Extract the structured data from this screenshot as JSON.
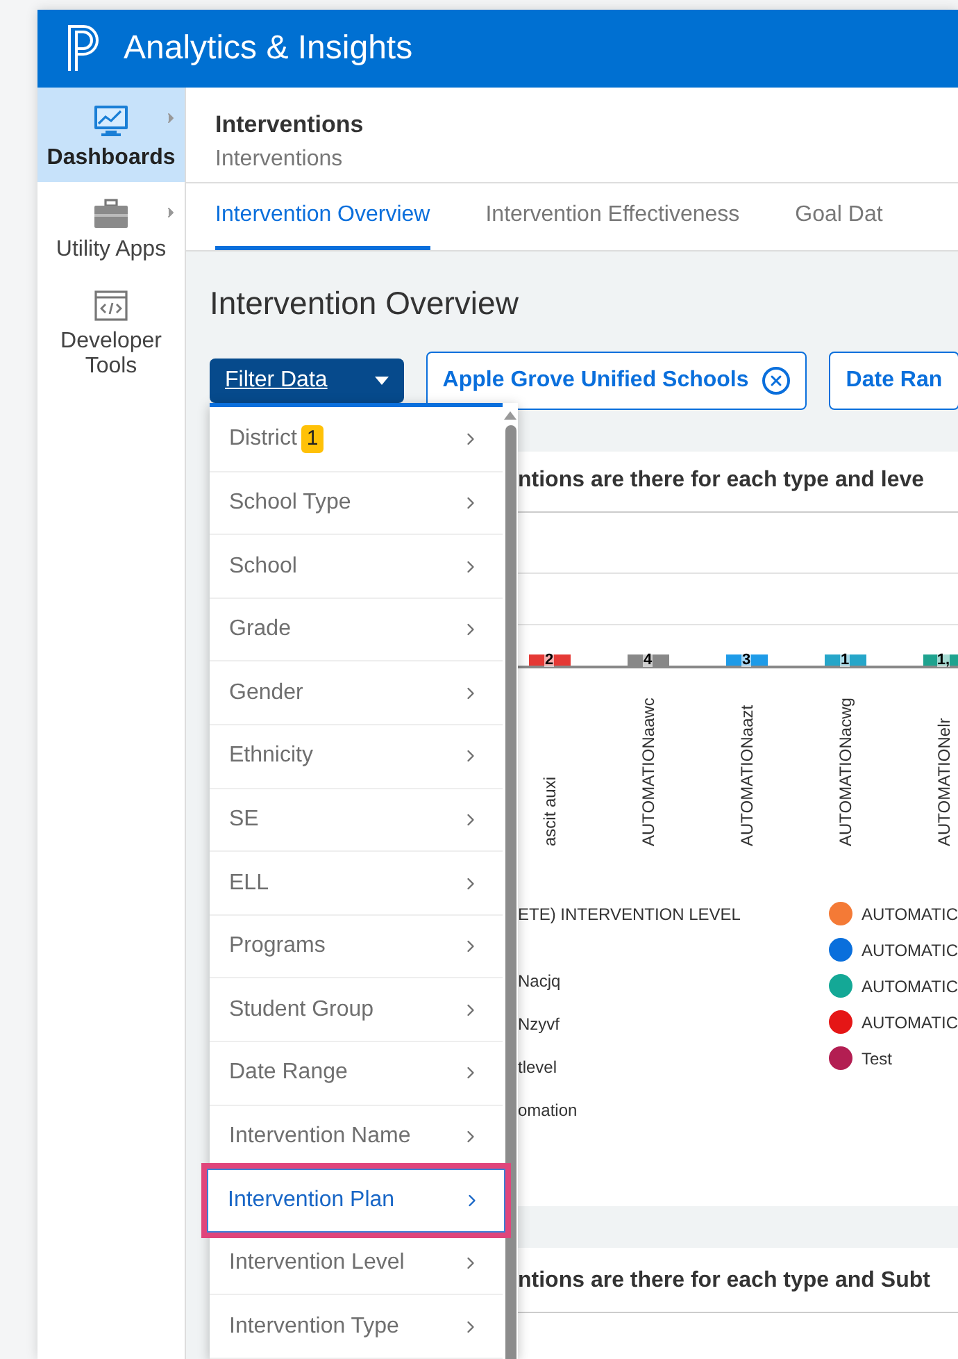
{
  "app": {
    "title": "Analytics & Insights"
  },
  "sidebar": {
    "items": [
      {
        "label": "Dashboards",
        "selected": true,
        "has_submenu": true
      },
      {
        "label": "Utility Apps",
        "selected": false,
        "has_submenu": true
      },
      {
        "label": "Developer Tools",
        "selected": false,
        "has_submenu": false
      }
    ]
  },
  "breadcrumb": {
    "title": "Interventions",
    "subtitle": "Interventions"
  },
  "tabs": [
    {
      "label": "Intervention Overview",
      "selected": true
    },
    {
      "label": "Intervention Effectiveness",
      "selected": false
    },
    {
      "label": "Goal Dat",
      "selected": false
    }
  ],
  "page_title": "Intervention Overview",
  "filter_button": {
    "label": "Filter Data",
    "expanded": true
  },
  "filter_chips": [
    {
      "label": "Apple Grove Unified Schools",
      "removable": true
    },
    {
      "label": "Date Ran",
      "removable": false
    }
  ],
  "filter_menu": {
    "items": [
      {
        "label": "District",
        "badge": "1",
        "selected": false
      },
      {
        "label": "School Type",
        "selected": false
      },
      {
        "label": "School",
        "selected": false
      },
      {
        "label": "Grade",
        "selected": false
      },
      {
        "label": "Gender",
        "selected": false
      },
      {
        "label": "Ethnicity",
        "selected": false
      },
      {
        "label": "SE",
        "selected": false
      },
      {
        "label": "ELL",
        "selected": false
      },
      {
        "label": "Programs",
        "selected": false
      },
      {
        "label": "Student Group",
        "selected": false
      },
      {
        "label": "Date Range",
        "selected": false
      },
      {
        "label": "Intervention Name",
        "selected": false
      },
      {
        "label": "Intervention Plan",
        "selected": true
      },
      {
        "label": "Intervention Level",
        "selected": false
      },
      {
        "label": "Intervention Type",
        "selected": false
      }
    ]
  },
  "chart_card": {
    "title": "ntions are there for each type and leve",
    "bars": [
      {
        "value": "2",
        "label": "ascit auxi",
        "color": "#e53935"
      },
      {
        "value": "4",
        "label": "AUTOMATIONaawc",
        "color": "#888888"
      },
      {
        "value": "3",
        "label": "AUTOMATIONaazt",
        "color": "#1e9be8"
      },
      {
        "value": "1",
        "label": "AUTOMATIONacwg",
        "color": "#26a6c9"
      },
      {
        "value": "1,",
        "label": "AUTOMATIONelr",
        "color": "#1fa38f"
      }
    ],
    "legend_heading": "ETE) INTERVENTION LEVEL",
    "legend_left": [
      "Nacjq",
      "Nzyvf",
      "tlevel",
      "omation"
    ],
    "legend_right": [
      {
        "label": "AUTOMATIC",
        "color": "#f47a36"
      },
      {
        "label": "AUTOMATIC",
        "color": "#0a6fdc"
      },
      {
        "label": "AUTOMATIC",
        "color": "#14a896"
      },
      {
        "label": "AUTOMATIC",
        "color": "#e51616"
      },
      {
        "label": "Test",
        "color": "#b31e52"
      }
    ]
  },
  "second_card": {
    "title": "ntions are there for each type and Subt"
  }
}
